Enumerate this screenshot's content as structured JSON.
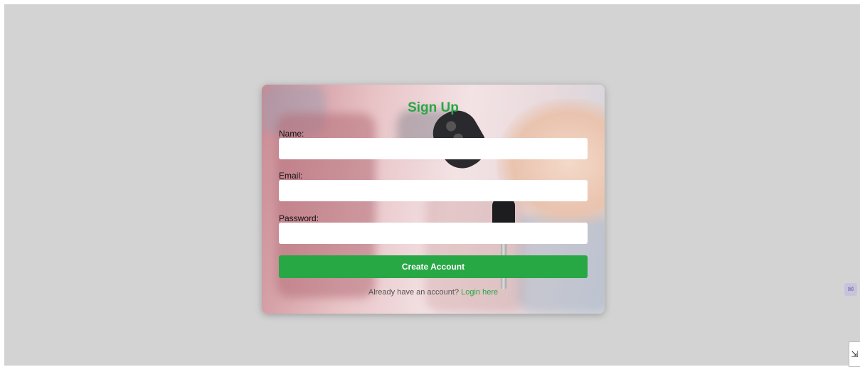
{
  "form": {
    "title": "Sign Up",
    "name_label": "Name:",
    "email_label": "Email:",
    "password_label": "Password:",
    "name_value": "",
    "email_value": "",
    "password_value": "",
    "submit_label": "Create Account",
    "footer_text": "Already have an account?",
    "login_link": "Login here"
  },
  "colors": {
    "page_bg": "#d3d3d3",
    "accent": "#28a745"
  },
  "icons": {
    "floating": "mail-icon",
    "corner": "resize-icon"
  }
}
